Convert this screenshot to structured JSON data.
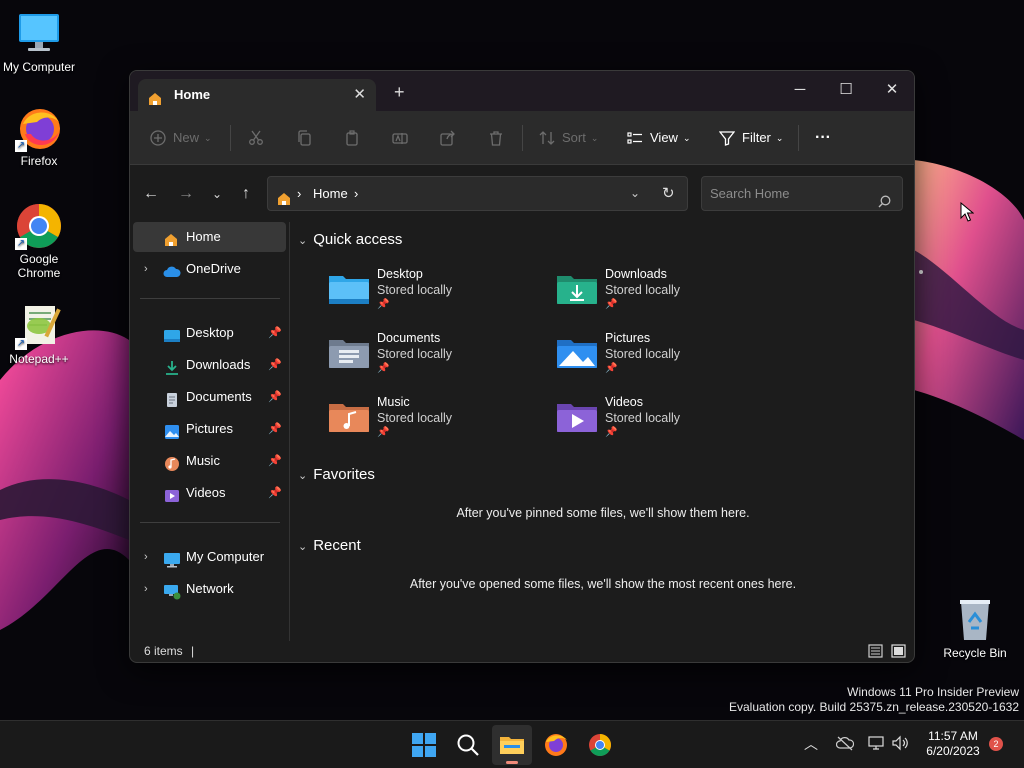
{
  "desktop": {
    "icons": [
      {
        "label": "My Computer"
      },
      {
        "label": "Firefox"
      },
      {
        "label": "Google Chrome"
      },
      {
        "label": "Notepad++"
      },
      {
        "label": "Recycle Bin"
      }
    ]
  },
  "explorer": {
    "tab_title": "Home",
    "toolbar": {
      "new_label": "New",
      "sort_label": "Sort",
      "view_label": "View",
      "filter_label": "Filter",
      "more_label": "···"
    },
    "address": {
      "location": "Home",
      "separator": "›"
    },
    "search": {
      "placeholder": "Search Home"
    },
    "sidebar": {
      "top": [
        {
          "label": "Home"
        },
        {
          "label": "OneDrive"
        }
      ],
      "pinned": [
        {
          "label": "Desktop"
        },
        {
          "label": "Downloads"
        },
        {
          "label": "Documents"
        },
        {
          "label": "Pictures"
        },
        {
          "label": "Music"
        },
        {
          "label": "Videos"
        }
      ],
      "bottom": [
        {
          "label": "My Computer"
        },
        {
          "label": "Network"
        }
      ]
    },
    "sections": {
      "quick_access": "Quick access",
      "favorites": "Favorites",
      "recent": "Recent"
    },
    "quick_access": [
      {
        "name": "Desktop",
        "status": "Stored locally",
        "color": "#2fa6e8"
      },
      {
        "name": "Downloads",
        "status": "Stored locally",
        "color": "#27b28c"
      },
      {
        "name": "Documents",
        "status": "Stored locally",
        "color": "#8d9bb0"
      },
      {
        "name": "Pictures",
        "status": "Stored locally",
        "color": "#2f8ff0"
      },
      {
        "name": "Music",
        "status": "Stored locally",
        "color": "#e8885a"
      },
      {
        "name": "Videos",
        "status": "Stored locally",
        "color": "#8c63d8"
      }
    ],
    "favorites_empty": "After you've pinned some files, we'll show them here.",
    "recent_empty": "After you've opened some files, we'll show the most recent ones here.",
    "status": {
      "items_count": "6 items"
    }
  },
  "watermark": {
    "line1": "Windows 11 Pro Insider Preview",
    "line2": "Evaluation copy. Build 25375.zn_release.230520-1632"
  },
  "taskbar": {
    "time": "11:57 AM",
    "date": "6/20/2023",
    "notification_count": "2"
  }
}
